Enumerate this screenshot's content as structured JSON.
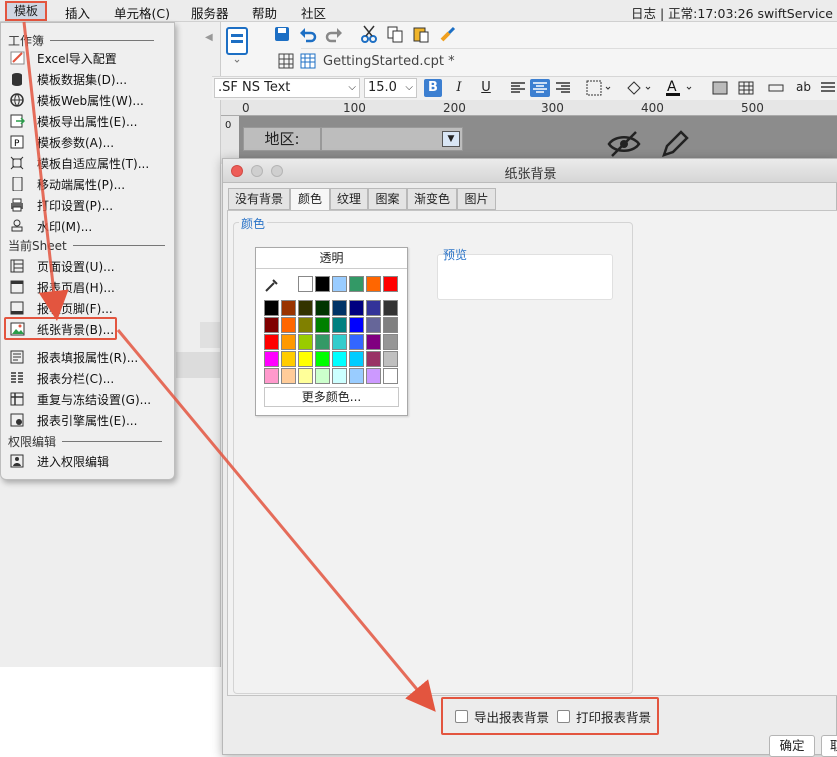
{
  "menubar": {
    "items": [
      "模板",
      "插入",
      "单元格(C)",
      "服务器",
      "帮助",
      "社区"
    ],
    "status": "日志 | 正常:17:03:26 swiftService"
  },
  "dropdown": {
    "sections": [
      {
        "title": "工作簿",
        "items": [
          {
            "label": "Excel导入配置",
            "icon": "excel-import-icon"
          },
          {
            "label": "模板数据集(D)...",
            "icon": "database-icon"
          },
          {
            "label": "模板Web属性(W)...",
            "icon": "globe-icon"
          },
          {
            "label": "模板导出属性(E)...",
            "icon": "export-icon"
          },
          {
            "label": "模板参数(A)...",
            "icon": "parameter-icon"
          },
          {
            "label": "模板自适应属性(T)...",
            "icon": "adaptive-icon"
          },
          {
            "label": "移动端属性(P)...",
            "icon": "mobile-icon"
          },
          {
            "label": "打印设置(P)...",
            "icon": "printer-icon"
          },
          {
            "label": "水印(M)...",
            "icon": "watermark-icon"
          }
        ]
      },
      {
        "title": "当前Sheet",
        "items": [
          {
            "label": "页面设置(U)...",
            "icon": "page-setup-icon"
          },
          {
            "label": "报表页眉(H)...",
            "icon": "header-icon"
          },
          {
            "label": "报表页脚(F)...",
            "icon": "footer-icon"
          },
          {
            "label": "纸张背景(B)...",
            "icon": "paper-background-icon"
          },
          {
            "label": "报表填报属性(R)...",
            "icon": "fill-report-icon"
          },
          {
            "label": "报表分栏(C)...",
            "icon": "columns-icon"
          },
          {
            "label": "重复与冻结设置(G)...",
            "icon": "freeze-icon"
          },
          {
            "label": "报表引擎属性(E)...",
            "icon": "engine-icon"
          }
        ]
      },
      {
        "title": "权限编辑",
        "items": [
          {
            "label": "进入权限编辑",
            "icon": "permission-icon"
          }
        ]
      }
    ]
  },
  "editor": {
    "file_tab": "GettingStarted.cpt *",
    "font": ".SF NS Text",
    "font_size": "15.0",
    "bold": "B",
    "italic": "I",
    "underline": "U",
    "ruler_ticks": [
      "0",
      "100",
      "200",
      "300",
      "400",
      "500"
    ],
    "vruler_tick": "0",
    "cell_label": "地区:"
  },
  "dialog": {
    "title": "纸张背景",
    "tabs": [
      "没有背景",
      "颜色",
      "纹理",
      "图案",
      "渐变色",
      "图片"
    ],
    "active_tab": 1,
    "group_label": "颜色",
    "transparent_label": "透明",
    "more_colors": "更多颜色...",
    "preview_label": "预览",
    "export_bg": "导出报表背景",
    "print_bg": "打印报表背景",
    "ok": "确定",
    "cancel": "取"
  },
  "palette": {
    "recent": [
      "#ffffff",
      "#000000",
      "#99ccff",
      "#339966",
      "#ff6600",
      "#ff0000"
    ],
    "rows": [
      [
        "#000000",
        "#993300",
        "#333300",
        "#003300",
        "#003366",
        "#000080",
        "#333399",
        "#333333"
      ],
      [
        "#800000",
        "#ff6600",
        "#808000",
        "#008000",
        "#008080",
        "#0000ff",
        "#666699",
        "#808080"
      ],
      [
        "#ff0000",
        "#ff9900",
        "#99cc00",
        "#339966",
        "#33cccc",
        "#3366ff",
        "#800080",
        "#969696"
      ],
      [
        "#ff00ff",
        "#ffcc00",
        "#ffff00",
        "#00ff00",
        "#00ffff",
        "#00ccff",
        "#993366",
        "#c0c0c0"
      ],
      [
        "#ff99cc",
        "#ffcc99",
        "#ffff99",
        "#ccffcc",
        "#ccffff",
        "#99ccff",
        "#cc99ff",
        "#ffffff"
      ]
    ]
  },
  "colors": {
    "highlight": "#e3553f",
    "accent": "#2a73c7"
  }
}
